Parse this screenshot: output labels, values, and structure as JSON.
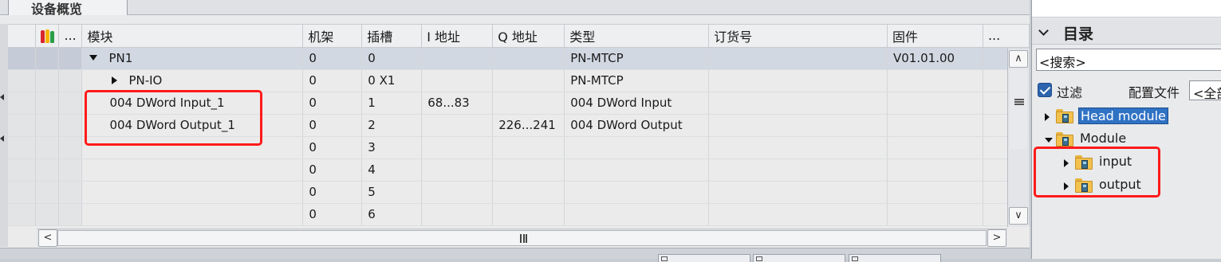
{
  "overview": {
    "tab_label": "设备概览",
    "columns": {
      "dots1": "...",
      "module": "模块",
      "rack": "机架",
      "slot": "插槽",
      "i_addr": "I 地址",
      "q_addr": "Q 地址",
      "type": "类型",
      "order": "订货号",
      "firmware": "固件",
      "dots2": "..."
    },
    "rows": [
      {
        "module": "PN1",
        "rack": "0",
        "slot": "0",
        "i_addr": "",
        "q_addr": "",
        "type": "PN-MTCP",
        "order": "",
        "firmware": "V01.01.00"
      },
      {
        "module": "PN-IO",
        "rack": "0",
        "slot": "0 X1",
        "i_addr": "",
        "q_addr": "",
        "type": "PN-MTCP",
        "order": "",
        "firmware": ""
      },
      {
        "module": "004 DWord Input_1",
        "rack": "0",
        "slot": "1",
        "i_addr": "68...83",
        "q_addr": "",
        "type": "004 DWord Input",
        "order": "",
        "firmware": ""
      },
      {
        "module": "004 DWord Output_1",
        "rack": "0",
        "slot": "2",
        "i_addr": "",
        "q_addr": "226...241",
        "type": "004 DWord Output",
        "order": "",
        "firmware": ""
      },
      {
        "module": "",
        "rack": "0",
        "slot": "3",
        "i_addr": "",
        "q_addr": "",
        "type": "",
        "order": "",
        "firmware": ""
      },
      {
        "module": "",
        "rack": "0",
        "slot": "4",
        "i_addr": "",
        "q_addr": "",
        "type": "",
        "order": "",
        "firmware": ""
      },
      {
        "module": "",
        "rack": "0",
        "slot": "5",
        "i_addr": "",
        "q_addr": "",
        "type": "",
        "order": "",
        "firmware": ""
      },
      {
        "module": "",
        "rack": "0",
        "slot": "6",
        "i_addr": "",
        "q_addr": "",
        "type": "",
        "order": "",
        "firmware": ""
      }
    ],
    "scroll": {
      "up": "∧",
      "down": "∨",
      "left": "<",
      "right": ">"
    }
  },
  "catalog": {
    "title": "目录",
    "search_value": "<搜索>",
    "filter_label": "过滤",
    "profile_label": "配置文件",
    "profile_value": "<全部>",
    "tree": [
      {
        "label": "Head module",
        "expanded": false,
        "selected": true
      },
      {
        "label": "Module",
        "expanded": true,
        "selected": false
      },
      {
        "label": "input",
        "expanded": false,
        "selected": false
      },
      {
        "label": "output",
        "expanded": false,
        "selected": false
      }
    ]
  },
  "colors": {
    "highlight_box": "#ff1a1a",
    "selection": "#3072c4"
  },
  "icons": [
    "wrench-status-icon",
    "expand-arrow-icon",
    "collapse-arrow-icon",
    "folder-module-icon",
    "checkbox-checked-icon",
    "chevron-down-icon",
    "scroll-up-icon",
    "scroll-down-icon",
    "scroll-left-icon",
    "scroll-right-icon",
    "scroll-grip-icon"
  ]
}
